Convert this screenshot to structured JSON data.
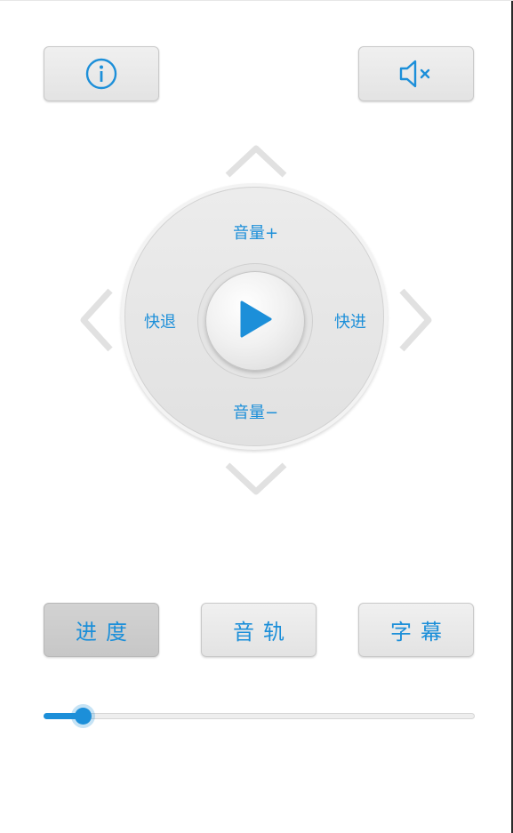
{
  "top_buttons": {
    "info_icon": "info-icon",
    "mute_icon": "mute-icon"
  },
  "dpad": {
    "up_label": "音量+",
    "down_label": "音量−",
    "left_label": "快退",
    "right_label": "快进",
    "center_icon": "play-icon"
  },
  "bottom_buttons": {
    "progress_label": "进度",
    "audio_track_label": "音轨",
    "subtitle_label": "字幕",
    "selected": "progress"
  },
  "slider": {
    "value_fraction": 0.09
  },
  "colors": {
    "accent": "#1c8fd9",
    "button_bg": "#e8e8e8",
    "button_pressed_bg": "#cdcdcd",
    "background": "#ffffff"
  }
}
